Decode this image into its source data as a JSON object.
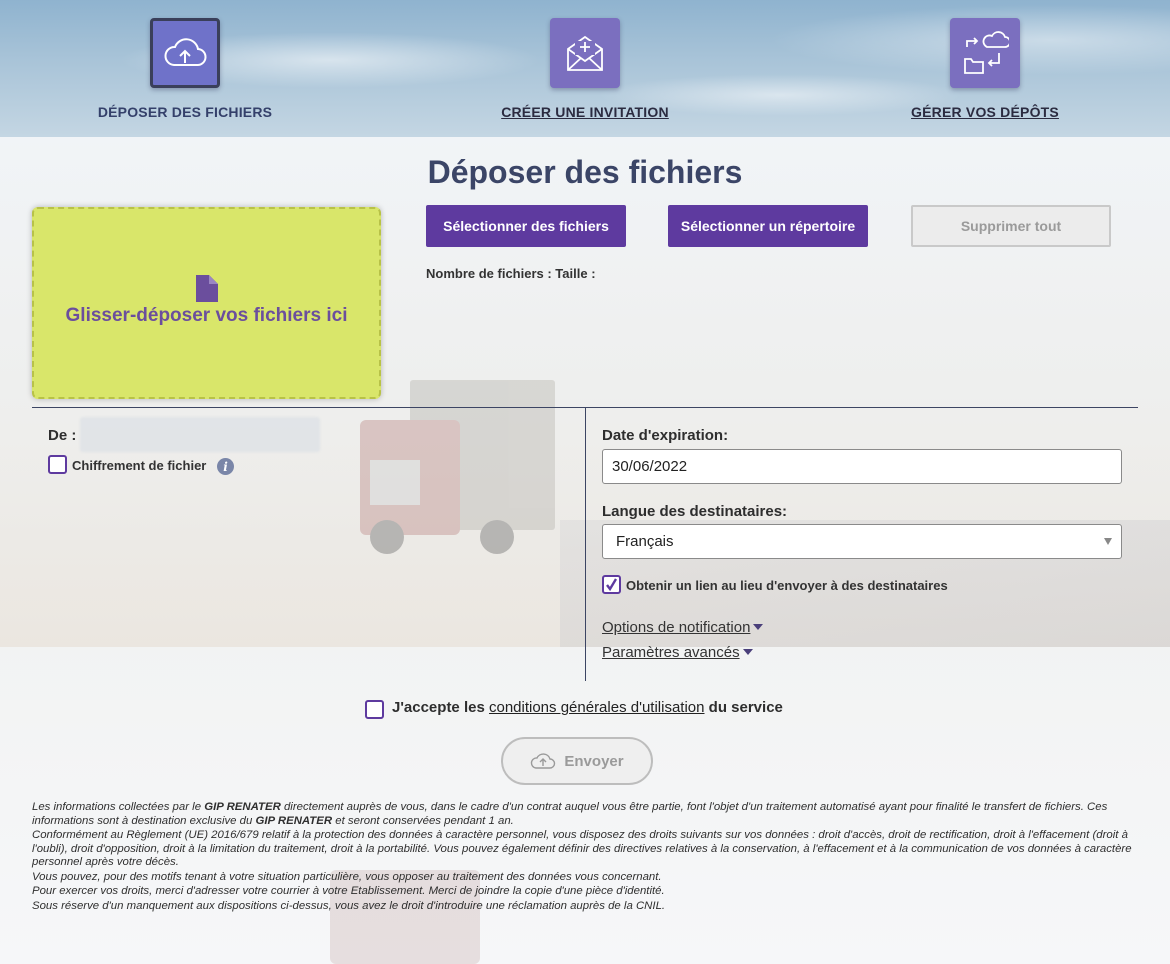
{
  "nav": {
    "items": [
      {
        "label": "DÉPOSER DES FICHIERS",
        "icon": "cloud-upload-icon"
      },
      {
        "label": "CRÉER UNE INVITATION",
        "icon": "envelope-plus-icon"
      },
      {
        "label": "GÉRER VOS DÉPÔTS",
        "icon": "transfers-icon"
      }
    ]
  },
  "title": "Déposer des fichiers",
  "dropzone": {
    "text": "Glisser-déposer vos fichiers ici",
    "icon": "file-icon"
  },
  "buttons": {
    "select_files": "Sélectionner des fichiers",
    "select_dir": "Sélectionner un répertoire",
    "delete_all": "Supprimer tout"
  },
  "file_count": "Nombre de fichiers : Taille :",
  "form": {
    "from_label": "De :",
    "encryption_label": "Chiffrement de fichier",
    "expiry_label": "Date d'expiration:",
    "expiry_value": "30/06/2022",
    "lang_label": "Langue des destinataires:",
    "lang_value": "Français",
    "link_label": "Obtenir un lien au lieu d'envoyer à des destinataires",
    "link_checked": true,
    "notif_options": "Options de notification",
    "advanced": "Paramètres avancés"
  },
  "terms": {
    "prefix": "J'accepte les",
    "link": "conditions générales d'utilisation",
    "suffix": "du service"
  },
  "send": "Envoyer",
  "legal": {
    "p1a": "Les informations collectées par le ",
    "p1b": "GIP RENATER",
    "p1c": " directement auprès de vous, dans le cadre d'un contrat auquel vous être partie, font l'objet d'un traitement automatisé ayant pour finalité le transfert de fichiers. Ces informations sont à destination exclusive du ",
    "p1d": "GIP RENATER",
    "p1e": " et seront conservées pendant 1 an.",
    "p2": "Conformément au Règlement (UE) 2016/679 relatif à la protection des données à caractère personnel, vous disposez des droits suivants sur vos données : droit d'accès, droit de rectification, droit à l'effacement (droit à l'oubli), droit d'opposition, droit à la limitation du traitement, droit à la portabilité. Vous pouvez également définir des directives relatives à la conservation, à l'effacement et à la communication de vos données à caractère personnel après votre décès.",
    "p3": "Vous pouvez, pour des motifs tenant à votre situation particulière, vous opposer au traitement des données vous concernant.",
    "p4": "Pour exercer vos droits, merci d'adresser votre courrier à votre Etablissement. Merci de joindre la copie d'une pièce d'identité.",
    "p5": "Sous réserve d'un manquement aux dispositions ci-dessus, vous avez le droit d'introduire une réclamation auprès de la CNIL."
  },
  "colors": {
    "accent": "#5e3a9f",
    "dropzone": "#d9e66a",
    "title": "#3b4567"
  }
}
